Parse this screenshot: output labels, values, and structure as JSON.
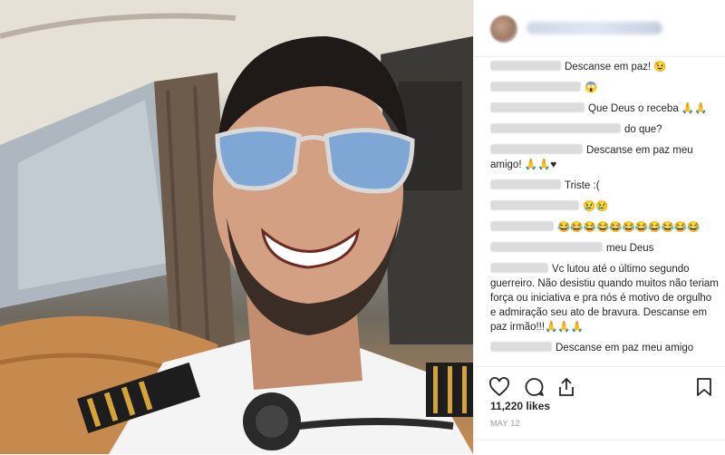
{
  "post": {
    "image_alt": "",
    "likes_text": "11,220 likes",
    "date_text": "MAY 12"
  },
  "comments": [
    {
      "text": "Descanse em paz! 😉"
    },
    {
      "text": "😱"
    },
    {
      "text": "Que Deus o receba 🙏🙏"
    },
    {
      "text": "do que?"
    },
    {
      "text": "Descanse em paz meu amigo! 🙏🙏♥"
    },
    {
      "text": "Triste :("
    },
    {
      "text": "😢😢"
    },
    {
      "text": "😂😂😂😂😂😂😂😂😂😂😂"
    },
    {
      "text": "meu Deus"
    },
    {
      "text": "Vc lutou até o último segundo guerreiro. Não desistiu quando muitos não teriam força ou iniciativa e pra nós é motivo de orgulho e admiração seu ato de bravura. Descanse em paz irmão!!!🙏🙏🙏"
    },
    {
      "text": "Descanse em paz meu amigo"
    }
  ],
  "icons": {
    "like": "heart-icon",
    "comment": "comment-icon",
    "share": "share-icon",
    "save": "bookmark-icon"
  },
  "colors": {
    "text": "#262626",
    "muted": "#999999",
    "border": "#efefef"
  }
}
